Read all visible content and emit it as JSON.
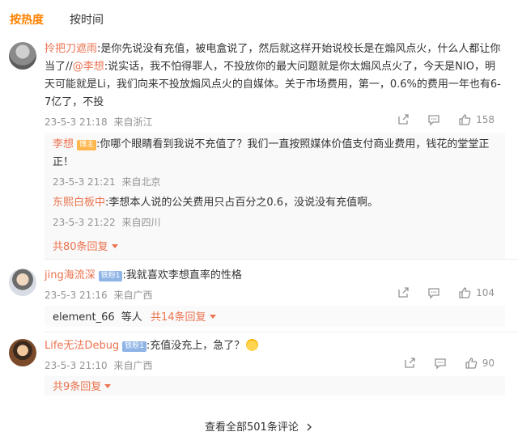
{
  "sort_tabs": [
    "按热度",
    "按时间"
  ],
  "comments": [
    {
      "user": "拎把刀遮雨",
      "text_before": ":是你先说没有充值，被电盒说了，然后就这样开始说校长是在煽风点火，什么人都让你当了//",
      "mention": "@李想",
      "text_after": ":说实话，我不怕得罪人，不投放你的最大问题就是你太煽风点火了，今天是NIO，明天可能就是Li，我们向来不投放煽风点火的自媒体。关于市场费用，第一，0.6%的费用一年也有6-7亿了，不投",
      "time": "23-5-3 21:18",
      "location": "来自浙江",
      "likes": "158",
      "replies": [
        {
          "user": "李想",
          "badge": "博主",
          "text": ":你哪个眼睛看到我说不充值了？我们一直按照媒体价值支付商业费用，钱花的堂堂正正！",
          "time": "23-5-3 21:21",
          "location": "来自北京"
        },
        {
          "user": "东熙白板中",
          "text": ":李想本人说的公关费用只占百分之0.6，没说没有充值啊。",
          "time": "23-5-3 21:22",
          "location": "来自四川"
        }
      ],
      "more_replies": "共80条回复"
    },
    {
      "user": "jing海流深",
      "badge": "铁粉1",
      "text": ":我就喜欢李想直率的性格",
      "time": "23-5-3 21:16",
      "location": "来自广西",
      "likes": "104",
      "reply_user": "element_66",
      "reply_mid": "等人",
      "more_replies": "共14条回复"
    },
    {
      "user": "Life无法Debug",
      "badge": "铁粉1",
      "text": ":充值没充上，急了？",
      "time": "23-5-3 21:10",
      "location": "来自广西",
      "likes": "90",
      "more_replies": "共9条回复"
    }
  ],
  "view_all": "查看全部501条评论",
  "icons": [
    "share-icon",
    "comment-icon",
    "like-icon",
    "chevron-right-icon"
  ],
  "colors": {
    "accent": "#ff8200",
    "username": "#eb7350",
    "meta": "#939393"
  }
}
